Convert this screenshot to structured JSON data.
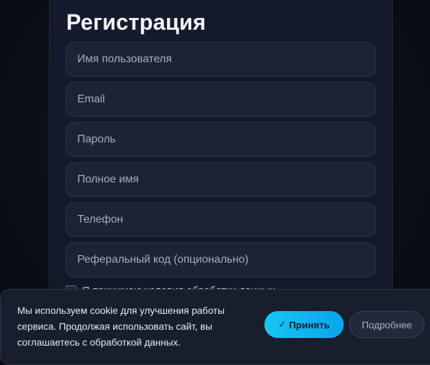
{
  "form": {
    "title": "Регистрация",
    "fields": [
      {
        "placeholder": "Имя пользователя",
        "value": ""
      },
      {
        "placeholder": "Email",
        "value": ""
      },
      {
        "placeholder": "Пароль",
        "value": ""
      },
      {
        "placeholder": "Полное имя",
        "value": ""
      },
      {
        "placeholder": "Телефон",
        "value": ""
      },
      {
        "placeholder": "Реферальный код (опционально)",
        "value": ""
      }
    ],
    "terms_label": "Я принимаю условия обработки данных"
  },
  "cookie_banner": {
    "text": "Мы используем cookie для улучшения работы сервиса. Продолжая использовать сайт, вы соглашаетесь с обработкой данных.",
    "accept_icon": "check-icon",
    "accept_check": "✓",
    "accept_label": "Принять",
    "more_label": "Подробнее"
  },
  "colors": {
    "background": "#0b0e16",
    "card": "#151b2c",
    "field": "#1d2333",
    "accent": "#14c7f2",
    "banner": "#181e2b"
  }
}
